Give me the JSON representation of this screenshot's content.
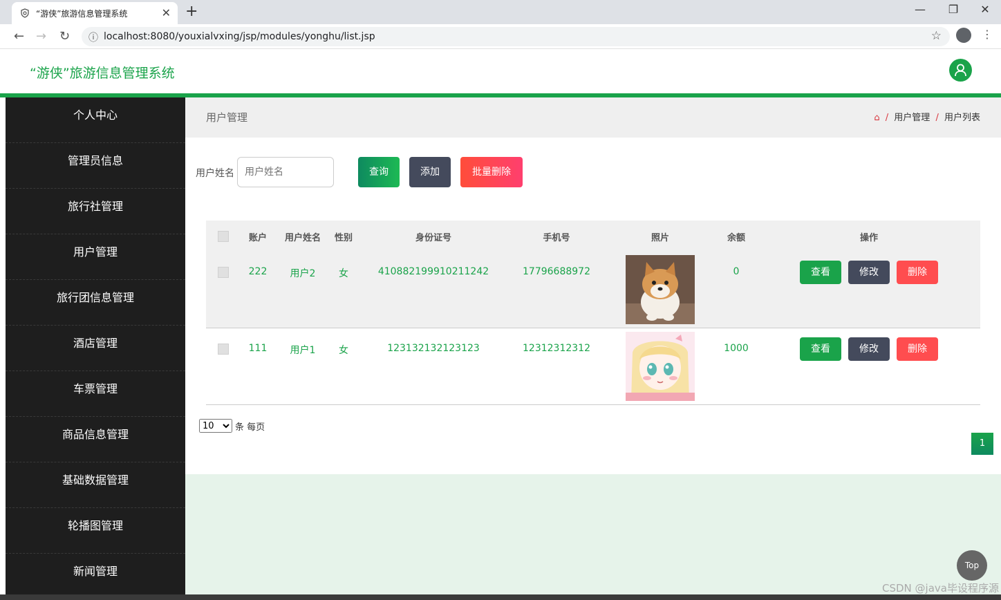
{
  "browser": {
    "tab_title": "“游侠”旅游信息管理系统",
    "tab_close": "✕",
    "new_tab": "+",
    "url": "localhost:8080/youxialvxing/jsp/modules/yonghu/list.jsp",
    "minimize": "—",
    "restore": "❐",
    "close": "✕"
  },
  "header": {
    "app_title": "“游侠”旅游信息管理系统"
  },
  "sidebar": {
    "items": [
      {
        "label": "个人中心"
      },
      {
        "label": "管理员信息"
      },
      {
        "label": "旅行社管理"
      },
      {
        "label": "用户管理"
      },
      {
        "label": "旅行团信息管理"
      },
      {
        "label": "酒店管理"
      },
      {
        "label": "车票管理"
      },
      {
        "label": "商品信息管理"
      },
      {
        "label": "基础数据管理"
      },
      {
        "label": "轮播图管理"
      },
      {
        "label": "新闻管理"
      }
    ]
  },
  "breadcrumb": {
    "page_title": "用户管理",
    "sep": "/",
    "level1": "用户管理",
    "level2": "用户列表"
  },
  "search": {
    "label": "用户姓名",
    "placeholder": "用户姓名",
    "query_label": "查询",
    "add_label": "添加",
    "batch_delete_label": "批量删除"
  },
  "table": {
    "headers": [
      "账户",
      "用户姓名",
      "性别",
      "身份证号",
      "手机号",
      "照片",
      "余额",
      "操作"
    ],
    "rows": [
      {
        "account": "222",
        "name": "用户2",
        "gender": "女",
        "id_number": "410882199910211242",
        "phone": "17796688972",
        "photo": "shiba-dog-photo",
        "balance": "0"
      },
      {
        "account": "111",
        "name": "用户1",
        "gender": "女",
        "id_number": "123132132123123",
        "phone": "12312312312",
        "photo": "anime-girl-photo",
        "balance": "1000"
      }
    ],
    "actions": {
      "view": "查看",
      "edit": "修改",
      "delete": "删除"
    }
  },
  "pagination": {
    "page_size": "10",
    "page_size_label": "条 每页",
    "current_page": "1"
  },
  "top_button": "Top",
  "watermark": "CSDN @java毕设程序源",
  "colors": {
    "brand_green": "#1aa34a",
    "sidebar_bg": "#1e1e1e",
    "danger": "#ff4d4f",
    "dark_button": "#444a5c"
  }
}
